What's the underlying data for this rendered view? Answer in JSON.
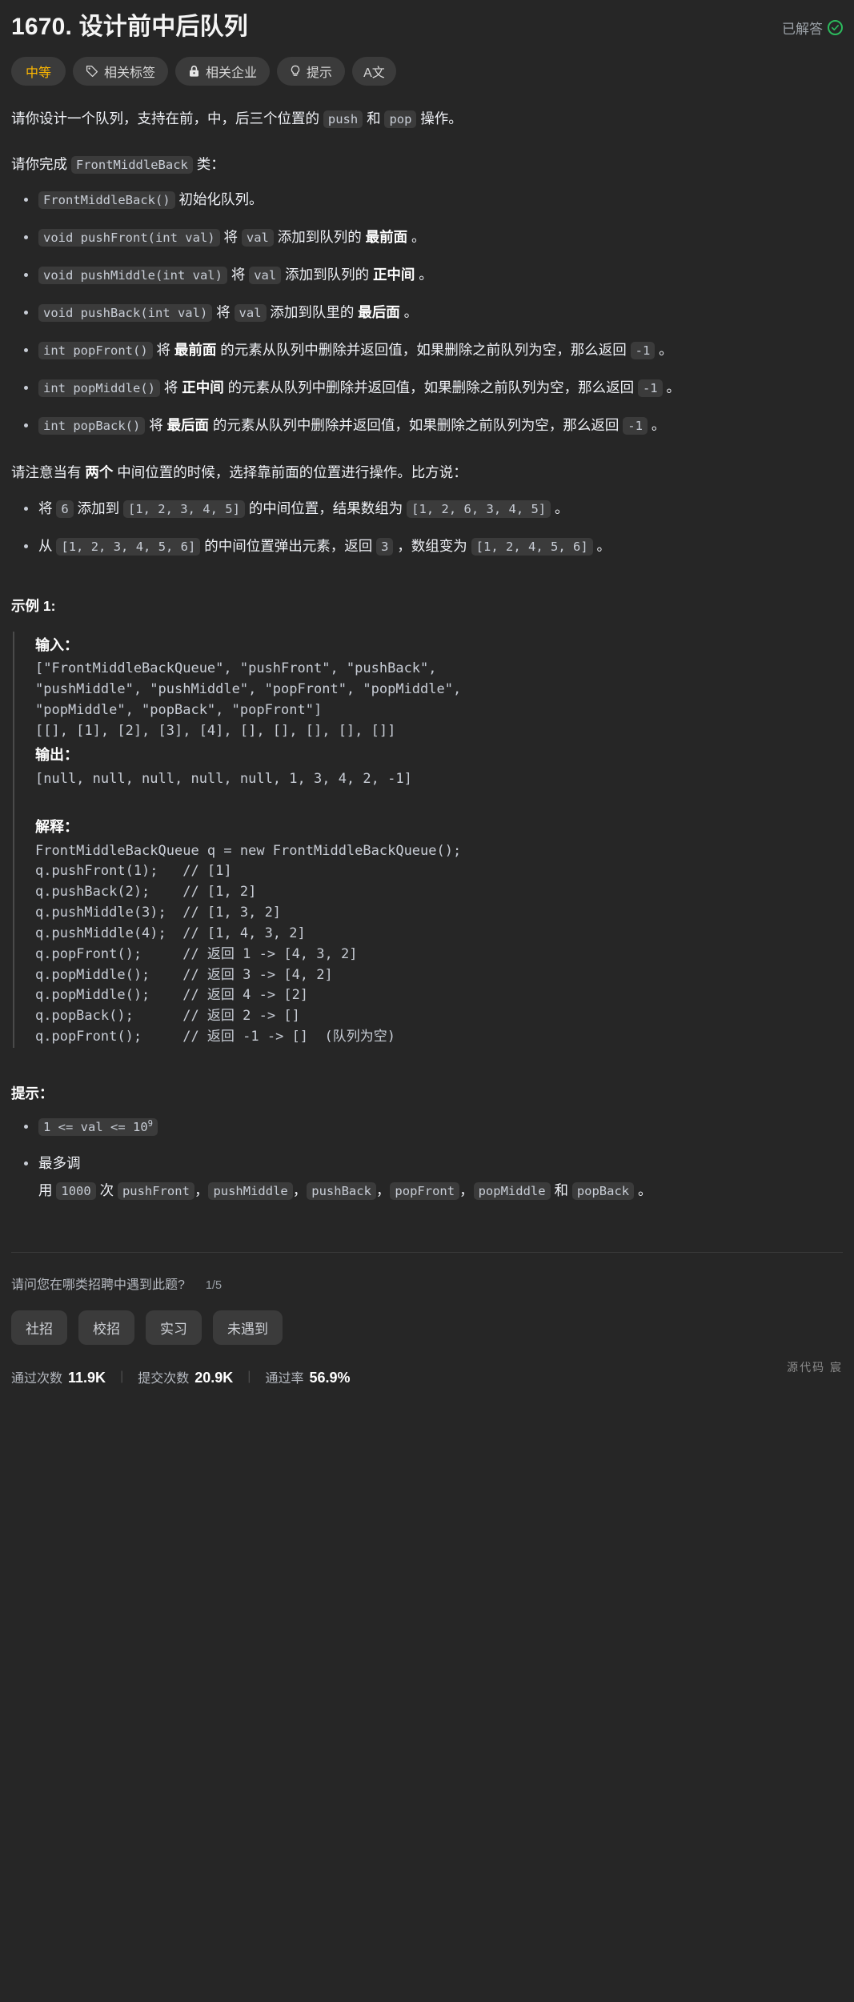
{
  "header": {
    "title": "1670. 设计前中后队列",
    "status_label": "已解答",
    "status_color": "#2cbb5d"
  },
  "tags": [
    {
      "label": "中等",
      "icon": "none",
      "accent": "#ffb800"
    },
    {
      "label": "相关标签",
      "icon": "tag-icon"
    },
    {
      "label": "相关企业",
      "icon": "lock-icon"
    },
    {
      "label": "提示",
      "icon": "bulb-icon"
    },
    {
      "label": "A文",
      "icon": "translate-icon"
    }
  ],
  "description": {
    "intro_p1_a": "请你设计一个队列，支持在前，中，后三个位置的 ",
    "intro_p1_code1": "push",
    "intro_p1_b": " 和 ",
    "intro_p1_code2": "pop",
    "intro_p1_c": " 操作。",
    "intro_p2_a": "请你完成 ",
    "intro_p2_code": "FrontMiddleBack",
    "intro_p2_b": " 类：",
    "methods": [
      {
        "code": "FrontMiddleBack()",
        "text_a": " 初始化队列。",
        "bold": "",
        "text_b": ""
      },
      {
        "code": "void pushFront(int val)",
        "text_a": " 将 ",
        "code2": "val",
        "text_b": " 添加到队列的 ",
        "bold": "最前面",
        "text_c": " 。"
      },
      {
        "code": "void pushMiddle(int val)",
        "text_a": " 将 ",
        "code2": "val",
        "text_b": " 添加到队列的 ",
        "bold": "正中间",
        "text_c": " 。"
      },
      {
        "code": "void pushBack(int val)",
        "text_a": " 将 ",
        "code2": "val",
        "text_b": " 添加到队里的 ",
        "bold": "最后面",
        "text_c": " 。"
      },
      {
        "code": "int popFront()",
        "text_a": " 将 ",
        "bold": "最前面",
        "text_b": " 的元素从队列中删除并返回值，如果删除之前队列为空，那么返回 ",
        "code2": "-1",
        "text_c": " 。"
      },
      {
        "code": "int popMiddle()",
        "text_a": " 将 ",
        "bold": "正中间",
        "text_b": " 的元素从队列中删除并返回值，如果删除之前队列为空，那么返回 ",
        "code2": "-1",
        "text_c": " 。"
      },
      {
        "code": "int popBack()",
        "text_a": " 将 ",
        "bold": "最后面",
        "text_b": " 的元素从队列中删除并返回值，如果删除之前队列为空，那么返回 ",
        "code2": "-1",
        "text_c": " 。"
      }
    ],
    "note_a": "请注意当有 ",
    "note_bold": "两个",
    "note_b": " 中间位置的时候，选择靠前面的位置进行操作。比方说：",
    "note_items": [
      {
        "t1": "将 ",
        "c1": "6",
        "t2": " 添加到 ",
        "c2": "[1, 2, 3, 4, 5]",
        "t3": " 的中间位置，结果数组为 ",
        "c3": "[1, 2, 6, 3, 4, 5]",
        "t4": " 。"
      },
      {
        "t1": "从 ",
        "c1": "[1, 2, 3, 4, 5, 6]",
        "t2": " 的中间位置弹出元素，返回 ",
        "c2": "3",
        "t3": " ，数组变为 ",
        "c3": "[1, 2, 4, 5, 6]",
        "t4": " 。"
      }
    ]
  },
  "example": {
    "title": "示例 1:",
    "input_label": "输入：",
    "input_value": "[\"FrontMiddleBackQueue\", \"pushFront\", \"pushBack\",\n\"pushMiddle\", \"pushMiddle\", \"popFront\", \"popMiddle\",\n\"popMiddle\", \"popBack\", \"popFront\"]\n[[], [1], [2], [3], [4], [], [], [], [], []]",
    "output_label": "输出：",
    "output_value": "[null, null, null, null, null, 1, 3, 4, 2, -1]",
    "explain_label": "解释：",
    "explain_value": "FrontMiddleBackQueue q = new FrontMiddleBackQueue();\nq.pushFront(1);   // [1]\nq.pushBack(2);    // [1, 2]\nq.pushMiddle(3);  // [1, 3, 2]\nq.pushMiddle(4);  // [1, 4, 3, 2]\nq.popFront();     // 返回 1 -> [4, 3, 2]\nq.popMiddle();    // 返回 3 -> [4, 2]\nq.popMiddle();    // 返回 4 -> [2]\nq.popBack();      // 返回 2 -> []\nq.popFront();     // 返回 -1 -> []  (队列为空)"
  },
  "constraints": {
    "title": "提示：",
    "item1_code_pre": "1 <= val <= 10",
    "item1_code_sup": "9",
    "item2_a": "最多调",
    "item2_b": "用 ",
    "item2_code_n": "1000",
    "item2_c": " 次 ",
    "item2_codes": [
      "pushFront",
      "pushMiddle",
      "pushBack",
      "popFront",
      "popMiddle"
    ],
    "item2_and": " 和 ",
    "item2_last_code": "popBack",
    "item2_end": " 。"
  },
  "survey": {
    "question": "请问您在哪类招聘中遇到此题?",
    "counter": "1/5",
    "options": [
      "社招",
      "校招",
      "实习",
      "未遇到"
    ]
  },
  "stats": [
    {
      "key": "通过次数",
      "value": "11.9K"
    },
    {
      "key": "提交次数",
      "value": "20.9K"
    },
    {
      "key": "通过率",
      "value": "56.9%"
    }
  ],
  "watermark": "源代码 宸"
}
